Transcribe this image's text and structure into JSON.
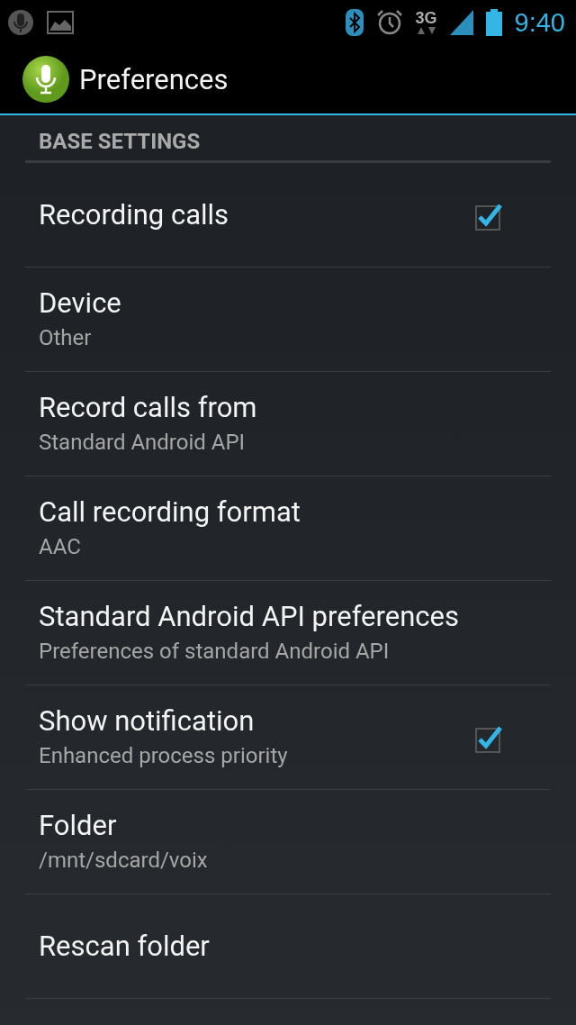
{
  "status_bar": {
    "network": "3G",
    "time": "9:40"
  },
  "action_bar": {
    "title": "Preferences"
  },
  "section": {
    "title": "BASE SETTINGS"
  },
  "preferences": [
    {
      "kind": "checkbox",
      "title": "Recording calls",
      "checked": true
    },
    {
      "kind": "plain",
      "title": "Device",
      "summary": "Other"
    },
    {
      "kind": "plain",
      "title": "Record calls from",
      "summary": "Standard Android API"
    },
    {
      "kind": "plain",
      "title": "Call recording format",
      "summary": "AAC"
    },
    {
      "kind": "plain",
      "title": "Standard Android API preferences",
      "summary": "Preferences of standard Android API"
    },
    {
      "kind": "checkbox",
      "title": "Show notification",
      "summary": "Enhanced process priority",
      "checked": true
    },
    {
      "kind": "plain",
      "title": "Folder",
      "summary": "/mnt/sdcard/voix"
    },
    {
      "kind": "plain",
      "title": "Rescan folder"
    }
  ]
}
